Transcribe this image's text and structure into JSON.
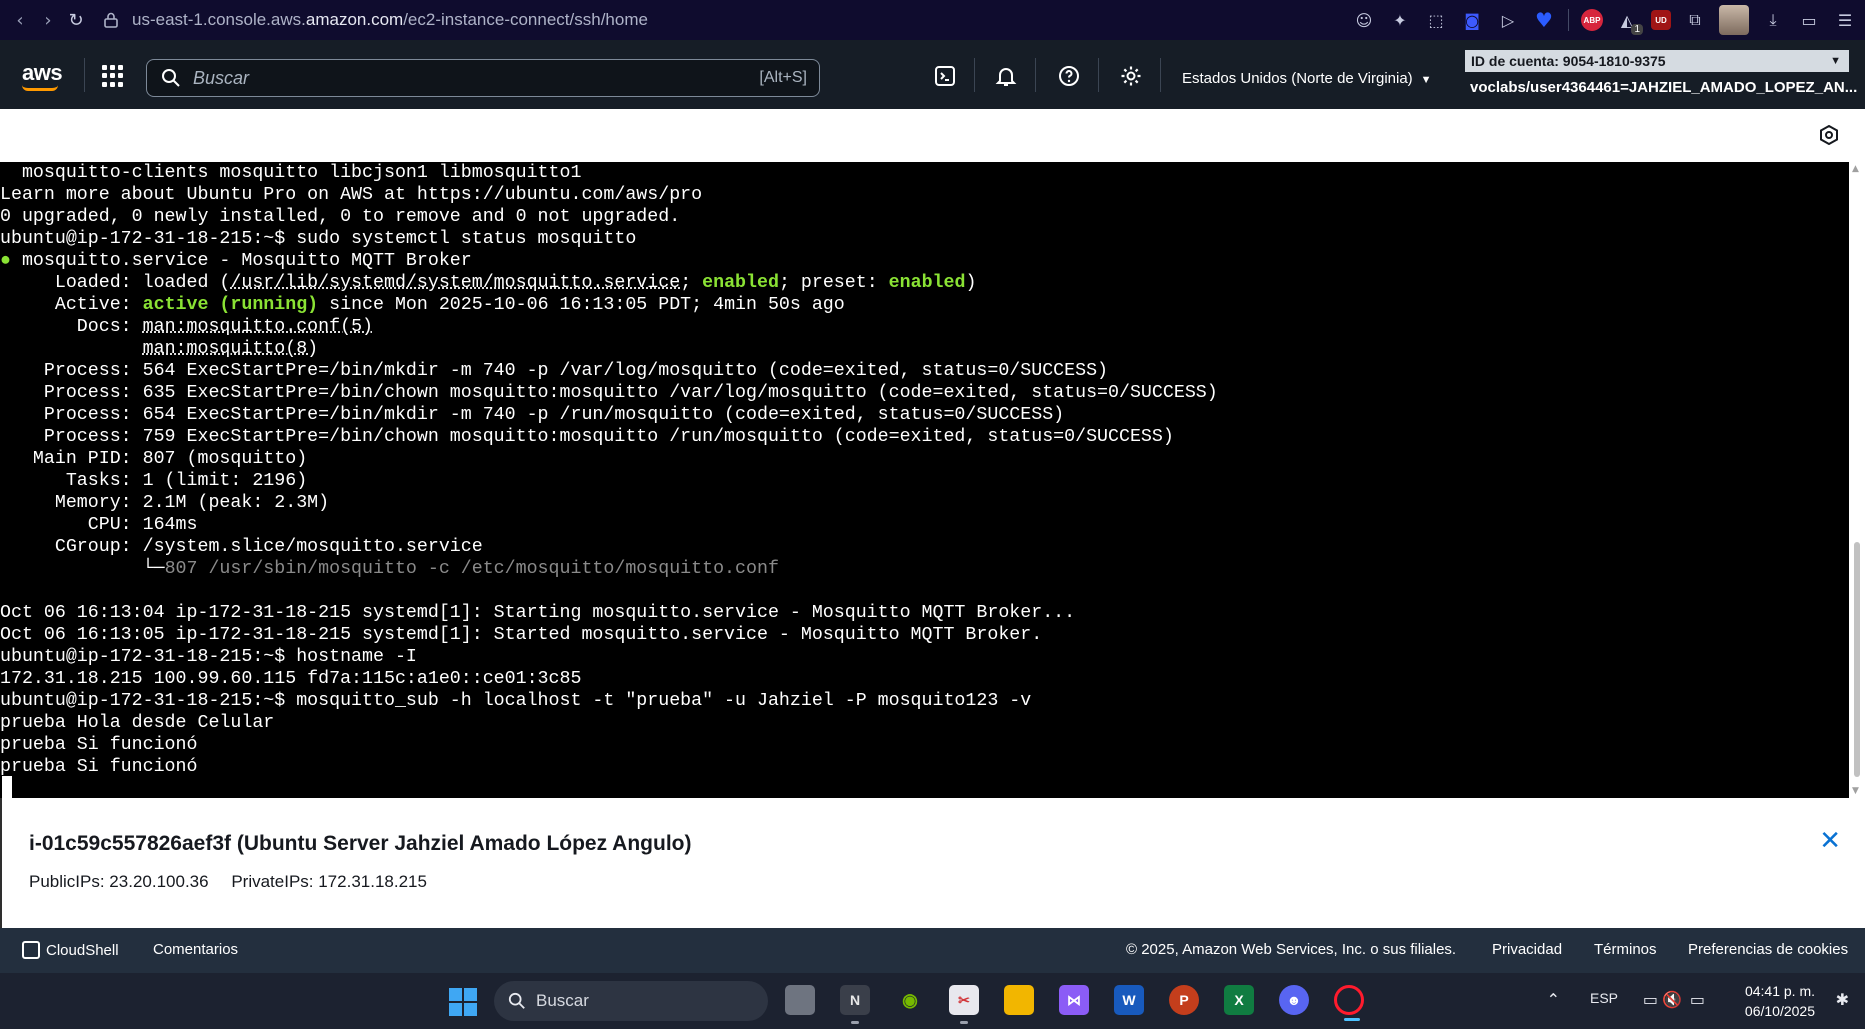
{
  "browser": {
    "url_prefix": "us-east-1.console.aws.",
    "url_host": "amazon.com",
    "url_path": "/ec2-instance-connect/ssh/home",
    "extensions": [
      "smiley-icon",
      "pin-icon",
      "screenshot-icon",
      "pocket-icon",
      "send-icon",
      "heart-icon",
      "adblock-icon",
      "ghostery-icon",
      "ublock-icon",
      "puzzle-icon"
    ],
    "abp_label": "ABP",
    "ublock_label": "UD",
    "ghostery_badge": "1"
  },
  "aws": {
    "logo": "aws",
    "search_placeholder": "Buscar",
    "search_shortcut": "[Alt+S]",
    "region": "Estados Unidos (Norte de Virginia)",
    "account": "ID de cuenta: 9054-1810-9375",
    "user": "voclabs/user4364461=JAHZIEL_AMADO_LOPEZ_AN..."
  },
  "terminal": {
    "lines": [
      [
        {
          "t": "  mosquitto-clients mosquitto libcjson1 libmosquitto1"
        }
      ],
      [
        {
          "t": "Learn more about Ubuntu Pro on AWS at https://ubuntu.com/aws/pro"
        }
      ],
      [
        {
          "t": "0 upgraded, 0 newly installed, 0 to remove and 0 not upgraded."
        }
      ],
      [
        {
          "t": "ubuntu@ip-172-31-18-215:~$ sudo systemctl status mosquitto"
        }
      ],
      [
        {
          "t": "●",
          "c": "g"
        },
        {
          "t": " mosquitto.service - Mosquitto MQTT Broker"
        }
      ],
      [
        {
          "t": "     Loaded: loaded ("
        },
        {
          "t": "/usr/lib/systemd/system/mosquitto.service",
          "c": "ul"
        },
        {
          "t": "; "
        },
        {
          "t": "enabled",
          "c": "g"
        },
        {
          "t": "; preset: "
        },
        {
          "t": "enabled",
          "c": "g"
        },
        {
          "t": ")"
        }
      ],
      [
        {
          "t": "     Active: "
        },
        {
          "t": "active (running)",
          "c": "g"
        },
        {
          "t": " since Mon 2025-10-06 16:13:05 PDT; 4min 50s ago"
        }
      ],
      [
        {
          "t": "       Docs: "
        },
        {
          "t": "man:mosquitto.conf(5)",
          "c": "ul"
        }
      ],
      [
        {
          "t": "             "
        },
        {
          "t": "man:mosquitto(8)",
          "c": "ul"
        }
      ],
      [
        {
          "t": "    Process: 564 ExecStartPre=/bin/mkdir -m 740 -p /var/log/mosquitto (code=exited, status=0/SUCCESS)"
        }
      ],
      [
        {
          "t": "    Process: 635 ExecStartPre=/bin/chown mosquitto:mosquitto /var/log/mosquitto (code=exited, status=0/SUCCESS)"
        }
      ],
      [
        {
          "t": "    Process: 654 ExecStartPre=/bin/mkdir -m 740 -p /run/mosquitto (code=exited, status=0/SUCCESS)"
        }
      ],
      [
        {
          "t": "    Process: 759 ExecStartPre=/bin/chown mosquitto:mosquitto /run/mosquitto (code=exited, status=0/SUCCESS)"
        }
      ],
      [
        {
          "t": "   Main PID: 807 (mosquitto)"
        }
      ],
      [
        {
          "t": "      Tasks: 1 (limit: 2196)"
        }
      ],
      [
        {
          "t": "     Memory: 2.1M (peak: 2.3M)"
        }
      ],
      [
        {
          "t": "        CPU: 164ms"
        }
      ],
      [
        {
          "t": "     CGroup: /system.slice/mosquitto.service"
        }
      ],
      [
        {
          "t": "             └─"
        },
        {
          "t": "807 /usr/sbin/mosquitto -c /etc/mosquitto/mosquitto.conf",
          "c": "dim"
        }
      ],
      [
        {
          "t": ""
        }
      ],
      [
        {
          "t": "Oct 06 16:13:04 ip-172-31-18-215 systemd[1]: Starting mosquitto.service - Mosquitto MQTT Broker..."
        }
      ],
      [
        {
          "t": "Oct 06 16:13:05 ip-172-31-18-215 systemd[1]: Started mosquitto.service - Mosquitto MQTT Broker."
        }
      ],
      [
        {
          "t": "ubuntu@ip-172-31-18-215:~$ hostname -I"
        }
      ],
      [
        {
          "t": "172.31.18.215 100.99.60.115 fd7a:115c:a1e0::ce01:3c85"
        }
      ],
      [
        {
          "t": "ubuntu@ip-172-31-18-215:~$ mosquitto_sub -h localhost -t \"prueba\" -u Jahziel -P mosquito123 -v"
        }
      ],
      [
        {
          "t": "prueba Hola desde Celular"
        }
      ],
      [
        {
          "t": "prueba Si funcionó"
        }
      ],
      [
        {
          "t": "prueba Si funcionó"
        }
      ]
    ]
  },
  "instance": {
    "title": "i-01c59c557826aef3f (Ubuntu Server Jahziel Amado López Angulo)",
    "public_ips": "PublicIPs: 23.20.100.36",
    "private_ips": "PrivateIPs: 172.31.18.215"
  },
  "footer": {
    "cloudshell": "CloudShell",
    "comments": "Comentarios",
    "copyright": "© 2025, Amazon Web Services, Inc. o sus filiales.",
    "privacy": "Privacidad",
    "terms": "Términos",
    "cookies": "Preferencias de cookies"
  },
  "taskbar": {
    "search": "Buscar",
    "apps": [
      "task-view",
      "notion",
      "nvidia",
      "snipping-tool",
      "file-explorer",
      "visual-studio",
      "word",
      "powerpoint",
      "excel",
      "discord",
      "opera"
    ],
    "language": "ESP",
    "time": "04:41 p. m.",
    "date": "06/10/2025"
  }
}
